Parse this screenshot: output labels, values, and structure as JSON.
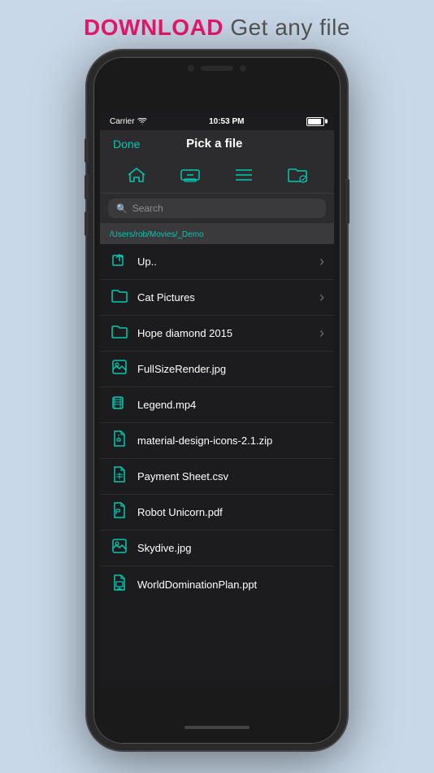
{
  "header": {
    "download_label": "DOWNLOAD",
    "subtitle": "Get any file"
  },
  "status_bar": {
    "carrier": "Carrier",
    "time": "10:53 PM"
  },
  "nav": {
    "done_label": "Done",
    "title": "Pick a file"
  },
  "toolbar": {
    "icons": [
      {
        "name": "home-icon",
        "symbol": "⌂"
      },
      {
        "name": "drive-icon",
        "symbol": "▭"
      },
      {
        "name": "list-icon",
        "symbol": "≡"
      },
      {
        "name": "folder-check-icon",
        "symbol": "📁"
      }
    ]
  },
  "search": {
    "placeholder": "Search"
  },
  "path": {
    "text": "/Users/rob/Movies/_Demo"
  },
  "files": [
    {
      "name": "Up..",
      "type": "up",
      "has_chevron": true
    },
    {
      "name": "Cat Pictures",
      "type": "folder",
      "has_chevron": true
    },
    {
      "name": "Hope diamond 2015",
      "type": "folder",
      "has_chevron": true
    },
    {
      "name": "FullSizeRender.jpg",
      "type": "image",
      "has_chevron": false
    },
    {
      "name": "Legend.mp4",
      "type": "video",
      "has_chevron": false
    },
    {
      "name": "material-design-icons-2.1.zip",
      "type": "zip",
      "has_chevron": false
    },
    {
      "name": "Payment Sheet.csv",
      "type": "csv",
      "has_chevron": false
    },
    {
      "name": "Robot Unicorn.pdf",
      "type": "pdf",
      "has_chevron": false
    },
    {
      "name": "Skydive.jpg",
      "type": "image",
      "has_chevron": false
    },
    {
      "name": "WorldDominationPlan.ppt",
      "type": "ppt",
      "has_chevron": false
    }
  ]
}
